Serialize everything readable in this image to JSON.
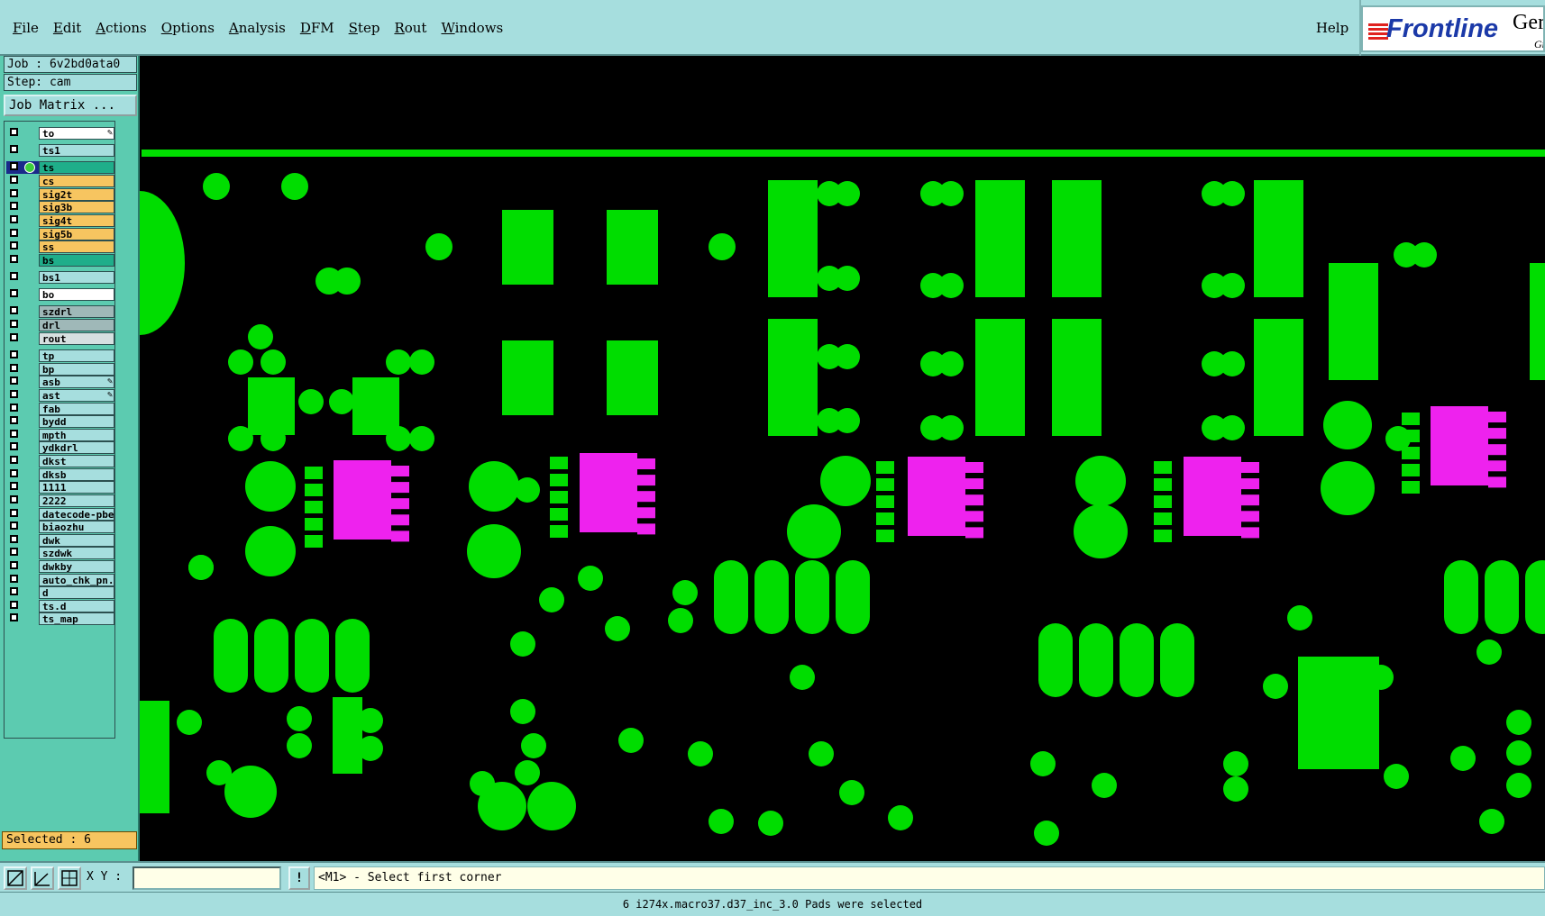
{
  "menu": {
    "items": [
      "File",
      "Edit",
      "Actions",
      "Options",
      "Analysis",
      "DFM",
      "Step",
      "Rout",
      "Windows"
    ],
    "help": "Help"
  },
  "logo": {
    "brand": "Frontline",
    "brand2": "Ger",
    "brand3": "Gr"
  },
  "panel": {
    "job": "Job : 6v2bd0ata0",
    "step": "Step: cam",
    "job_matrix": "Job Matrix ...",
    "selected": "Selected : 6"
  },
  "layers": [
    {
      "name": "to",
      "color": "#ffffff",
      "mark": "pen"
    },
    {
      "name": "ts1",
      "color": "#a6dede"
    },
    {
      "name": "ts",
      "color": "#1fae8a",
      "active": true
    },
    {
      "name": "cs",
      "color": "#f7c560"
    },
    {
      "name": "sig2t",
      "color": "#f7c560"
    },
    {
      "name": "sig3b",
      "color": "#f7c560"
    },
    {
      "name": "sig4t",
      "color": "#f7c560"
    },
    {
      "name": "sig5b",
      "color": "#f7c560"
    },
    {
      "name": "ss",
      "color": "#f7c560"
    },
    {
      "name": "bs",
      "color": "#1fae8a"
    },
    {
      "name": "bs1",
      "color": "#a6dede"
    },
    {
      "name": "bo",
      "color": "#ffffff"
    },
    {
      "name": "szdrl",
      "color": "#9fb8b8"
    },
    {
      "name": "drl",
      "color": "#9fb8b8"
    },
    {
      "name": "rout",
      "color": "#d6e0e0"
    },
    {
      "name": "tp",
      "color": "#a6dede"
    },
    {
      "name": "bp",
      "color": "#a6dede"
    },
    {
      "name": "asb",
      "color": "#a6dede",
      "mark": "pen"
    },
    {
      "name": "ast",
      "color": "#a6dede",
      "mark": "pen"
    },
    {
      "name": "fab",
      "color": "#a6dede"
    },
    {
      "name": "bydd",
      "color": "#a6dede"
    },
    {
      "name": "mpth",
      "color": "#a6dede"
    },
    {
      "name": "ydkdrl",
      "color": "#a6dede"
    },
    {
      "name": "dkst",
      "color": "#a6dede"
    },
    {
      "name": "dksb",
      "color": "#a6dede"
    },
    {
      "name": "1111",
      "color": "#a6dede"
    },
    {
      "name": "2222",
      "color": "#a6dede"
    },
    {
      "name": "datecode-pbe",
      "color": "#a6dede"
    },
    {
      "name": "biaozhu",
      "color": "#a6dede"
    },
    {
      "name": "dwk",
      "color": "#a6dede"
    },
    {
      "name": "szdwk",
      "color": "#a6dede"
    },
    {
      "name": "dwkby",
      "color": "#a6dede"
    },
    {
      "name": "auto_chk_pn.",
      "color": "#a6dede"
    },
    {
      "name": "d",
      "color": "#a6dede"
    },
    {
      "name": "ts.d",
      "color": "#a6dede"
    },
    {
      "name": "ts_map",
      "color": "#a6dede"
    }
  ],
  "bottom": {
    "xy_label": "X Y :",
    "xy_value": "",
    "exclaim": "!",
    "prompt": "<M1> - Select first corner",
    "status": "6 i274x.macro37.d37_inc_3.0 Pads were selected"
  },
  "colors": {
    "pad": "#00dd00",
    "selected_pad": "#ee22ee",
    "background": "#000000"
  },
  "icons": [
    "select-rect-icon",
    "measure-icon",
    "grid-icon",
    "check-icon",
    "pen-icon"
  ]
}
